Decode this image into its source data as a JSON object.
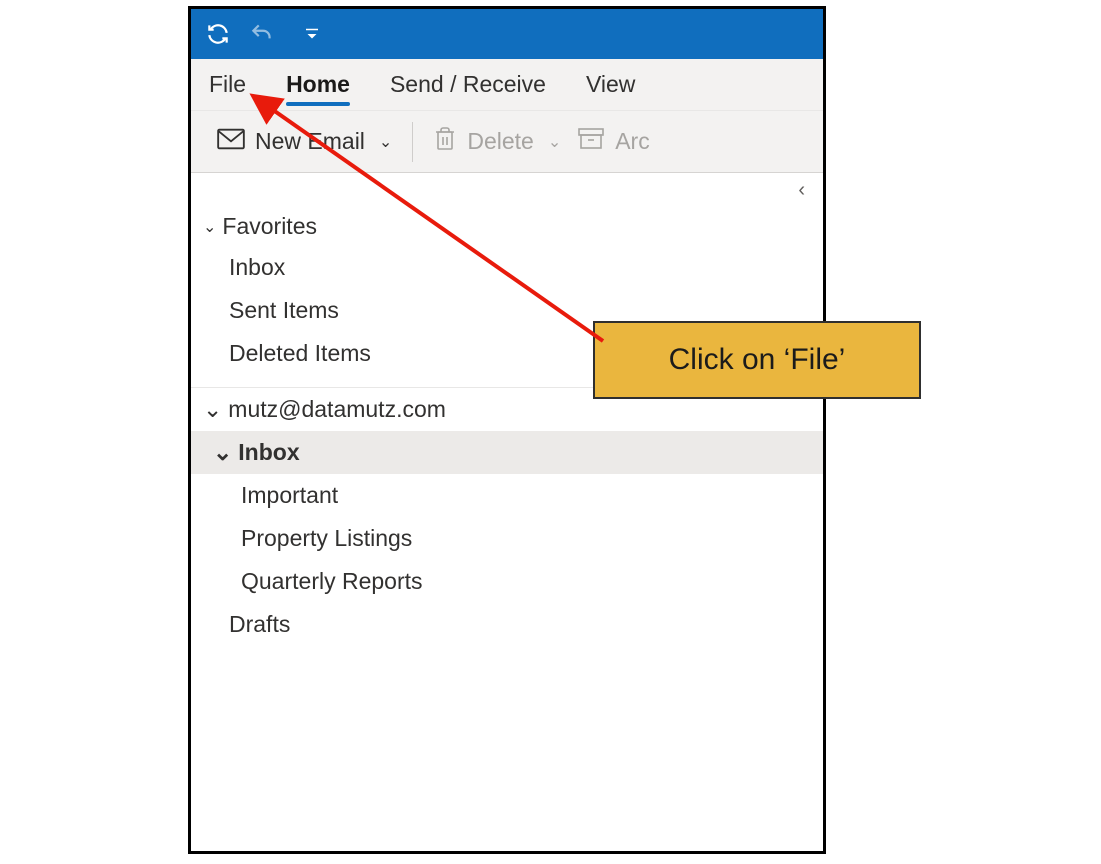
{
  "ribbon": {
    "tabs": {
      "file": "File",
      "home": "Home",
      "sendreceive": "Send / Receive",
      "view": "View"
    },
    "commands": {
      "newEmail": "New Email",
      "delete": "Delete",
      "archive": "Arc"
    }
  },
  "sidebar": {
    "favorites": {
      "header": "Favorites",
      "items": [
        "Inbox",
        "Sent Items",
        "Deleted Items"
      ]
    },
    "account": {
      "address": "mutz@datamutz.com",
      "inbox": "Inbox",
      "subfolders": [
        "Important",
        "Property Listings",
        "Quarterly Reports"
      ],
      "drafts": "Drafts"
    }
  },
  "callout": {
    "text": "Click on ‘File’"
  }
}
